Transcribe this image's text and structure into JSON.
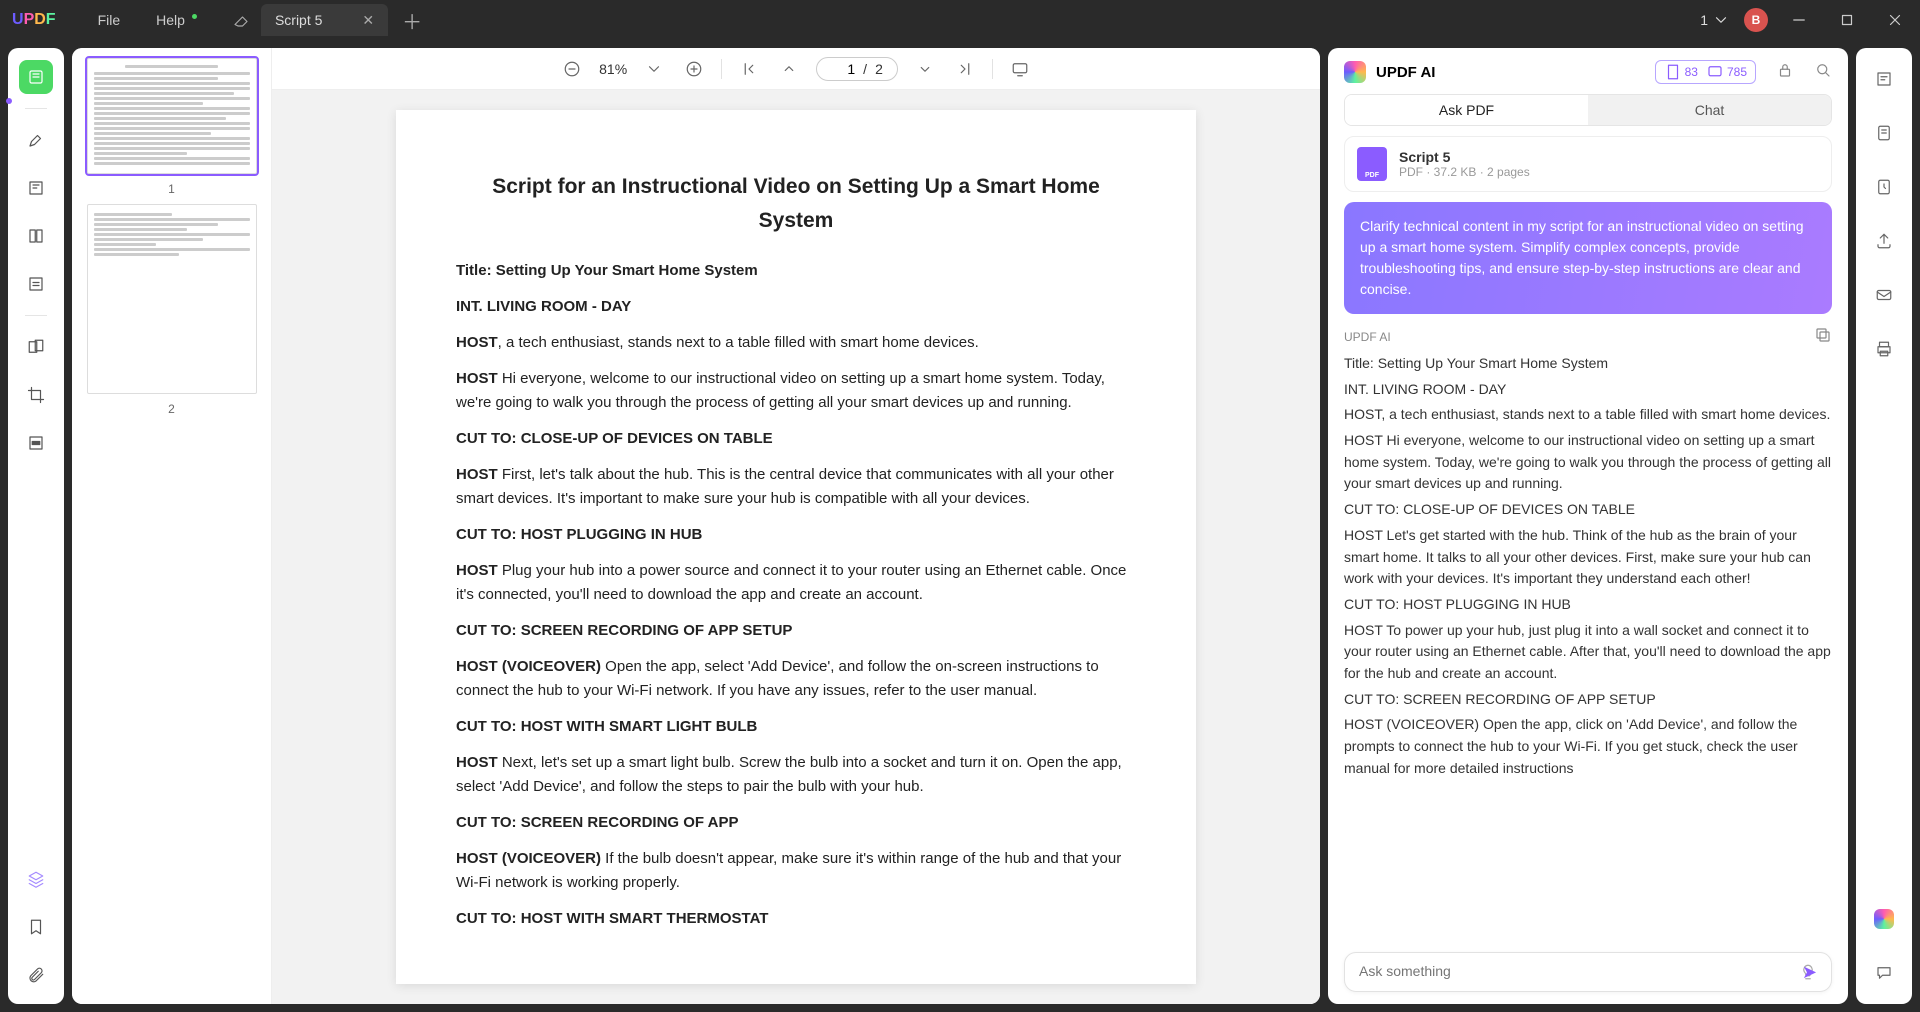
{
  "menu": {
    "file": "File",
    "help": "Help"
  },
  "tab": {
    "title": "Script 5",
    "count": "1"
  },
  "avatar_initial": "B",
  "toolbar": {
    "zoom": "81%",
    "page_current": "1",
    "page_sep": "/",
    "page_total": "2"
  },
  "thumbs": {
    "p1": "1",
    "p2": "2"
  },
  "doc": {
    "h": "Script for an Instructional Video on Setting Up a Smart Home System",
    "title_line": "Title: Setting Up Your Smart Home System",
    "scene": "INT. LIVING ROOM - DAY",
    "p1a": "HOST",
    "p1b": ", a tech enthusiast, stands next to a table filled with smart home devices.",
    "p2a": "HOST",
    "p2b": " Hi everyone, welcome to our instructional video on setting up a smart home system. Today, we're going to walk you through the process of getting all your smart devices up and running.",
    "cut1": "CUT TO: CLOSE-UP OF DEVICES ON TABLE",
    "p3a": "HOST",
    "p3b": " First, let's talk about the hub. This is the central device that communicates with all your other smart devices. It's important to make sure your hub is compatible with all your devices.",
    "cut2": "CUT TO: HOST PLUGGING IN HUB",
    "p4a": "HOST",
    "p4b": " Plug your hub into a power source and connect it to your router using an Ethernet cable. Once it's connected, you'll need to download the app and create an account.",
    "cut3": "CUT TO: SCREEN RECORDING OF APP SETUP",
    "p5a": "HOST (VOICEOVER)",
    "p5b": " Open the app, select 'Add Device', and follow the on-screen instructions to connect the hub to your Wi-Fi network. If you have any issues, refer to the user manual.",
    "cut4": "CUT TO: HOST WITH SMART LIGHT BULB",
    "p6a": "HOST",
    "p6b": " Next, let's set up a smart light bulb. Screw the bulb into a socket and turn it on. Open the app, select 'Add Device', and follow the steps to pair the bulb with your hub.",
    "cut5": "CUT TO: SCREEN RECORDING OF APP",
    "p7a": "HOST (VOICEOVER)",
    "p7b": " If the bulb doesn't appear, make sure it's within range of the hub and that your Wi-Fi network is working properly.",
    "cut6": "CUT TO: HOST WITH SMART THERMOSTAT"
  },
  "ai": {
    "title": "UPDF AI",
    "credit1": "83",
    "credit2": "785",
    "seg_ask": "Ask PDF",
    "seg_chat": "Chat",
    "file_name": "Script 5",
    "file_sub": "PDF · 37.2 KB · 2 pages",
    "user_msg": "Clarify technical content in my script for an instructional video on setting up a smart home system. Simplify complex concepts, provide troubleshooting tips, and ensure step-by-step instructions are clear and concise.",
    "resp_label": "UPDF AI",
    "resp_lines": [
      "Title: Setting Up Your Smart Home System",
      "INT. LIVING ROOM - DAY",
      "HOST, a tech enthusiast, stands next to a table filled with smart home devices.",
      "HOST Hi everyone, welcome to our instructional video on setting up a smart home system. Today, we're going to walk you through the process of getting all your smart devices up and running.",
      "CUT TO: CLOSE-UP OF DEVICES ON TABLE",
      "HOST Let's get started with the hub. Think of the hub as the brain of your smart home. It talks to all your other devices. First, make sure your hub can work with your devices. It's important they understand each other!",
      "CUT TO: HOST PLUGGING IN HUB",
      "HOST To power up your hub, just plug it into a wall socket and connect it to your router using an Ethernet cable. After that, you'll need to download the app for the hub and create an account.",
      "CUT TO: SCREEN RECORDING OF APP SETUP",
      "HOST (VOICEOVER) Open the app, click on 'Add Device', and follow the prompts to connect the hub to your Wi-Fi. If you get stuck, check the user manual for more detailed instructions"
    ],
    "ask_placeholder": "Ask something"
  }
}
